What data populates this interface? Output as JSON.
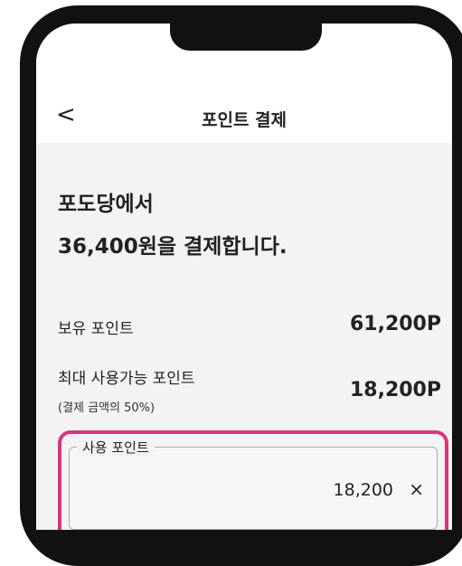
{
  "header": {
    "back_glyph": "<",
    "title": "포인트 결제"
  },
  "summary": {
    "payee": "포도당에서",
    "amount_line": "36,400원을 결제합니다."
  },
  "points": {
    "owned_label": "보유 포인트",
    "owned_value": "61,200P",
    "max_label": "최대 사용가능 포인트",
    "max_note": "(결제 금액의 50%)",
    "max_value": "18,200P"
  },
  "use_points": {
    "label": "사용 포인트",
    "value": "18,200",
    "clear_glyph": "×"
  },
  "colors": {
    "accent": "#d8357a",
    "screen_bg": "#f3f3f3",
    "phone_frame": "#111111"
  }
}
